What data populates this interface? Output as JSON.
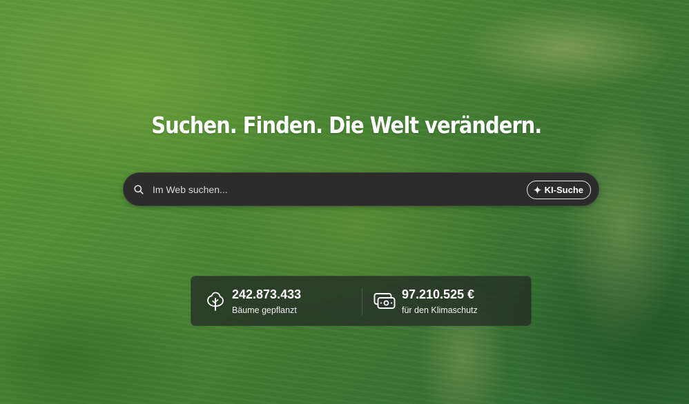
{
  "hero": {
    "headline": "Suchen. Finden. Die Welt verändern."
  },
  "search": {
    "placeholder": "Im Web suchen...",
    "icon": "search-icon",
    "ai_button_label": "KI-Suche",
    "ai_button_icon": "sparkle-icon"
  },
  "stats": {
    "trees": {
      "value": "242.873.433",
      "label": "Bäume gepflanzt",
      "icon": "tree-icon"
    },
    "climate": {
      "value": "97.210.525 €",
      "label": "für den Klimaschutz",
      "icon": "money-icon"
    }
  },
  "colors": {
    "search_bar_bg": "#2c2c2c",
    "stats_card_bg": "#263026",
    "text": "#ffffff"
  }
}
